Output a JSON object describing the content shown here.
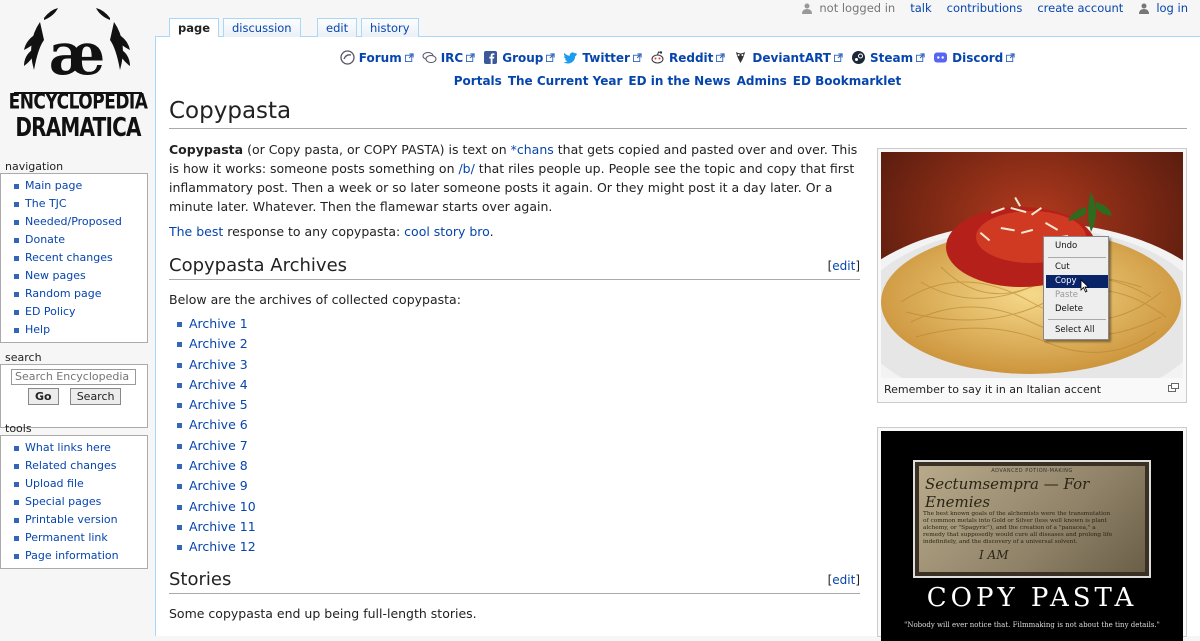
{
  "site": {
    "logo_text": [
      "ENCYCLOPEDIA",
      "DRAMATICA"
    ]
  },
  "personal": {
    "not_logged_in": "not logged in",
    "talk": "talk",
    "contributions": "contributions",
    "create_account": "create account",
    "log_in": "log in"
  },
  "tabs": {
    "page": "page",
    "discussion": "discussion",
    "edit": "edit",
    "history": "history"
  },
  "sitenav": {
    "primary": [
      {
        "label": "Forum",
        "icon": "forum-icon"
      },
      {
        "label": "IRC",
        "icon": "irc-icon"
      },
      {
        "label": "Group",
        "icon": "facebook-icon"
      },
      {
        "label": "Twitter",
        "icon": "twitter-icon"
      },
      {
        "label": "Reddit",
        "icon": "reddit-icon"
      },
      {
        "label": "DeviantART",
        "icon": "deviantart-icon"
      },
      {
        "label": "Steam",
        "icon": "steam-icon"
      },
      {
        "label": "Discord",
        "icon": "discord-icon"
      }
    ],
    "secondary": [
      "Portals",
      "The Current Year",
      "ED in the News",
      "Admins",
      "ED Bookmarklet"
    ]
  },
  "sidebar": {
    "navigation": {
      "title": "navigation",
      "items": [
        "Main page",
        "The TJC",
        "Needed/Proposed",
        "Donate",
        "Recent changes",
        "New pages",
        "Random page",
        "ED Policy",
        "Help"
      ]
    },
    "search": {
      "title": "search",
      "placeholder": "Search Encyclopedia",
      "go": "Go",
      "search": "Search"
    },
    "tools": {
      "title": "tools",
      "items": [
        "What links here",
        "Related changes",
        "Upload file",
        "Special pages",
        "Printable version",
        "Permanent link",
        "Page information"
      ]
    }
  },
  "page": {
    "title": "Copypasta",
    "intro": {
      "bold": "Copypasta",
      "t1": " (or Copy pasta, or COPY PASTA) is text on ",
      "link1": "*chans",
      "t2": " that gets copied and pasted over and over. This is how it works: someone posts something on ",
      "link2": "/b/",
      "t3": " that riles people up. People see the topic and copy that first inflammatory post. Then a week or so later someone posts it again. Or they might post it a day later. Or a minute later. Whatever. Then the flamewar starts over again."
    },
    "best": {
      "link1": "The best",
      "t1": " response to any copypasta: ",
      "link2": "cool story bro",
      "t2": "."
    },
    "sections": {
      "archives": {
        "title": "Copypasta Archives",
        "edit": "edit",
        "intro": "Below are the archives of collected copypasta:"
      },
      "stories": {
        "title": "Stories",
        "edit": "edit",
        "intro": "Some copypasta end up being full-length stories."
      }
    },
    "archives": [
      "Archive 1",
      "Archive 2",
      "Archive 3",
      "Archive 4",
      "Archive 5",
      "Archive 6",
      "Archive 7",
      "Archive 8",
      "Archive 9",
      "Archive 10",
      "Archive 11",
      "Archive 12"
    ],
    "edit_bracket_open": "[",
    "edit_bracket_close": "]"
  },
  "thumbs": {
    "spaghetti": {
      "caption": "Remember to say it in an Italian accent",
      "menu": [
        "Undo",
        "Cut",
        "Copy",
        "Paste",
        "Delete",
        "Select All"
      ]
    },
    "poster": {
      "title": "COPY PASTA",
      "tagline": "\"Nobody will ever notice that. Filmmaking is not about the tiny details.\"",
      "book_header": "ADVANCED POTION-MAKING",
      "book_title": "Sectumsempra — For Enemies",
      "book_text": "The best known goals of the alchemists were the transmutation of common metals into Gold or Silver (less well known is plant alchemy, or \"Spagyric\"), and the creation of a \"panacea,\" a remedy that supposedly would cure all diseases and prolong life indefinitely, and the discovery of a universal solvent.",
      "book_scribble": "I AM"
    }
  }
}
